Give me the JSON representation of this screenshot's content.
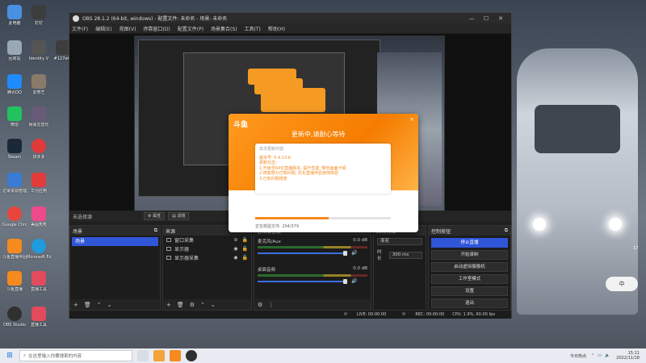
{
  "desktop": {
    "icons": [
      {
        "label": "此电脑",
        "color": "#4a90e2"
      },
      {
        "label": "回收站",
        "color": "#9aa7b5"
      },
      {
        "label": "腾讯QQ",
        "color": "#1f8bff"
      },
      {
        "label": "微信",
        "color": "#22c35e"
      },
      {
        "label": "Steam",
        "color": "#1b2838"
      },
      {
        "label": "记录资源管理",
        "color": "#3a7bd5"
      },
      {
        "label": "Google Chrome",
        "color": "#e8453c"
      },
      {
        "label": "Microsoft Edge",
        "color": "#1f9be0"
      },
      {
        "label": "斗鱼直播伴侣",
        "color": "#f58a1e"
      },
      {
        "label": "斗鱼直播",
        "color": "#f58a1e"
      },
      {
        "label": "OBS Studio",
        "color": "#303030"
      },
      {
        "label": "钉钉",
        "color": "#2a88ff"
      },
      {
        "label": "网易云音乐",
        "color": "#e03a3a"
      },
      {
        "label": "爱奇艺",
        "color": "#34c759"
      },
      {
        "label": "拼多多",
        "color": "#e02e24"
      },
      {
        "label": "美图秀秀",
        "color": "#ee4a8a"
      },
      {
        "label": "华为应用",
        "color": "#e23b3b"
      },
      {
        "label": "直播工具",
        "color": "#e24a5e"
      },
      {
        "label": "Identity V",
        "color": "#555555"
      },
      {
        "label": "#127ek5",
        "color": "#3d3d3d"
      }
    ],
    "weather_temp": "17",
    "ime_label": "中"
  },
  "obs": {
    "title": "OBS 28.1.2 (64-bit, windows) - 配置文件: 未命名 - 场景: 未命名",
    "menu": [
      "文件(F)",
      "编辑(E)",
      "视图(V)",
      "停靠窗口(D)",
      "配置文件(P)",
      "场景集合(S)",
      "工具(T)",
      "帮助(H)"
    ],
    "context_bar": {
      "scene_name": "未选择源",
      "properties": "属性",
      "filters": "滤镜"
    },
    "scenes": {
      "title": "场景",
      "items": [
        "场景"
      ]
    },
    "sources": {
      "title": "来源",
      "items": [
        "窗口采集",
        "显示器",
        "显示器采集"
      ]
    },
    "mixer": {
      "title": "音频混音器",
      "channels": [
        {
          "name": "麦克风/Aux",
          "db": "0.0 dB"
        },
        {
          "name": "桌面音频",
          "db": "0.0 dB"
        }
      ]
    },
    "transitions": {
      "title": "转场特效",
      "type": "渐变",
      "duration_label": "时长",
      "duration": "300 ms"
    },
    "controls": {
      "title": "控制按钮",
      "buttons": [
        "停止直播",
        "开始录制",
        "启动虚拟摄像机",
        "工作室模式",
        "设置",
        "退出"
      ]
    },
    "status": {
      "live": "LIVE: 00:00:00",
      "rec": "REC: 00:00:00",
      "cpu": "CPU: 1.9%, 60.00 fps"
    }
  },
  "updater": {
    "logo": "斗鱼",
    "heading": "更新中,请耐心等待",
    "close": "×",
    "card_caption": "本次更新内容:",
    "lines": [
      "版本号: 5.4.13.6",
      "更新日志:",
      "1.升级至64位直播版本, 提升性能, 降低画面卡顿",
      "2.修复部分已知问题, 优化直播伴侣使用体验",
      "3.已知问题修复"
    ],
    "progress_text": "正在校验文件: 204/379",
    "progress_value": 0.54,
    "accent": "#f58a1e"
  },
  "taskbar": {
    "start": "⊞",
    "search_placeholder": "在这里输入你要搜索的内容",
    "news": "今日热点",
    "time": "15:11",
    "date": "2022/11/18"
  }
}
